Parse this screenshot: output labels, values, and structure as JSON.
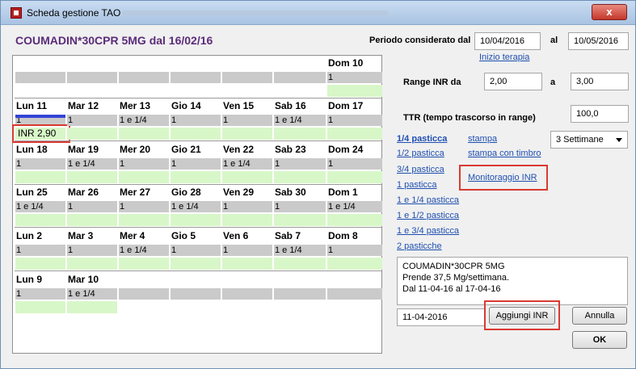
{
  "window": {
    "title": "Scheda gestione TAO",
    "close_label": "x"
  },
  "header": {
    "drug_title": "COUMADIN*30CPR 5MG dal 16/02/16",
    "period_label": "Periodo considerato dal",
    "period_from": "10/04/2016",
    "period_to_label": "al",
    "period_to": "10/05/2016",
    "therapy_start_link": "Inizio terapia"
  },
  "inr_range": {
    "label": "Range INR da",
    "from": "2,00",
    "to_label": "a",
    "to": "3,00"
  },
  "ttr": {
    "label": "TTR (tempo trascorso in range)",
    "value": "100,0"
  },
  "calendar": {
    "weeks": [
      {
        "days": [
          {
            "label": "",
            "dose": ""
          },
          {
            "label": "",
            "dose": ""
          },
          {
            "label": "",
            "dose": ""
          },
          {
            "label": "",
            "dose": ""
          },
          {
            "label": "",
            "dose": ""
          },
          {
            "label": "",
            "dose": ""
          },
          {
            "label": "Dom 10",
            "dose": "1"
          }
        ]
      },
      {
        "days": [
          {
            "label": "Lun 11",
            "dose": "1",
            "inr": "INR 2,90"
          },
          {
            "label": "Mar 12",
            "dose": "1"
          },
          {
            "label": "Mer 13",
            "dose": "1 e 1/4"
          },
          {
            "label": "Gio 14",
            "dose": "1"
          },
          {
            "label": "Ven 15",
            "dose": "1"
          },
          {
            "label": "Sab 16",
            "dose": "1 e 1/4"
          },
          {
            "label": "Dom 17",
            "dose": "1"
          }
        ]
      },
      {
        "days": [
          {
            "label": "Lun 18",
            "dose": "1"
          },
          {
            "label": "Mar 19",
            "dose": "1 e 1/4"
          },
          {
            "label": "Mer 20",
            "dose": "1"
          },
          {
            "label": "Gio 21",
            "dose": "1"
          },
          {
            "label": "Ven 22",
            "dose": "1 e 1/4"
          },
          {
            "label": "Sab 23",
            "dose": "1"
          },
          {
            "label": "Dom 24",
            "dose": "1"
          }
        ]
      },
      {
        "days": [
          {
            "label": "Lun 25",
            "dose": "1 e 1/4"
          },
          {
            "label": "Mar 26",
            "dose": "1"
          },
          {
            "label": "Mer 27",
            "dose": "1"
          },
          {
            "label": "Gio 28",
            "dose": "1 e 1/4"
          },
          {
            "label": "Ven 29",
            "dose": "1"
          },
          {
            "label": "Sab 30",
            "dose": "1"
          },
          {
            "label": "Dom 1",
            "dose": "1 e 1/4"
          }
        ]
      },
      {
        "days": [
          {
            "label": "Lun 2",
            "dose": "1"
          },
          {
            "label": "Mar 3",
            "dose": "1"
          },
          {
            "label": "Mer 4",
            "dose": "1 e 1/4"
          },
          {
            "label": "Gio 5",
            "dose": "1"
          },
          {
            "label": "Ven 6",
            "dose": "1"
          },
          {
            "label": "Sab 7",
            "dose": "1 e 1/4"
          },
          {
            "label": "Dom 8",
            "dose": "1"
          }
        ]
      },
      {
        "days": [
          {
            "label": "Lun 9",
            "dose": "1"
          },
          {
            "label": "Mar 10",
            "dose": "1 e 1/4"
          },
          {
            "label": "",
            "dose": ""
          },
          {
            "label": "",
            "dose": ""
          },
          {
            "label": "",
            "dose": ""
          },
          {
            "label": "",
            "dose": ""
          },
          {
            "label": "",
            "dose": ""
          }
        ]
      }
    ]
  },
  "dose_links": [
    "1/4 pasticca",
    "1/2 pasticca",
    "3/4 pasticca",
    "1 pasticca",
    "1 e 1/4 pasticca",
    "1 e 1/2 pasticca",
    "1 e 3/4 pasticca",
    "2 pasticche"
  ],
  "print_links": {
    "stampa": "stampa",
    "stampa_timbro": "stampa con timbro"
  },
  "monitoring_link": "Monitoraggio INR",
  "duration_select": "3 Settimane",
  "notes": {
    "line1": "COUMADIN*30CPR 5MG",
    "line2": "Prende 37,5 Mg/settimana.",
    "line3": "Dal 11-04-16 al 17-04-16"
  },
  "inr_date": "11-04-2016",
  "buttons": {
    "add_inr": "Aggiungi INR",
    "cancel": "Annulla",
    "ok": "OK"
  }
}
